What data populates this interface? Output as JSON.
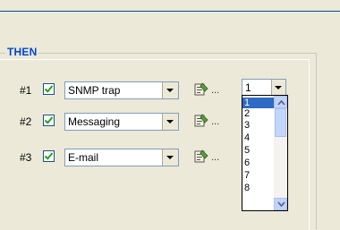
{
  "group": {
    "title": "THEN"
  },
  "actions": [
    {
      "number": "#1",
      "checked": true,
      "type": "SNMP trap"
    },
    {
      "number": "#2",
      "checked": true,
      "type": "Messaging"
    },
    {
      "number": "#3",
      "checked": true,
      "type": "E-mail"
    }
  ],
  "tool_dots": "...",
  "priority": {
    "selected": "1",
    "options": [
      "1",
      "2",
      "3",
      "4",
      "5",
      "6",
      "7",
      "8"
    ]
  },
  "icons": {
    "action_tool": "configure-icon",
    "scroll_up": "scroll-up-arrow-icon",
    "scroll_down": "scroll-down-arrow-icon"
  },
  "colors": {
    "title": "#0046d5",
    "selection": "#316ac5",
    "check": "#21a121"
  }
}
